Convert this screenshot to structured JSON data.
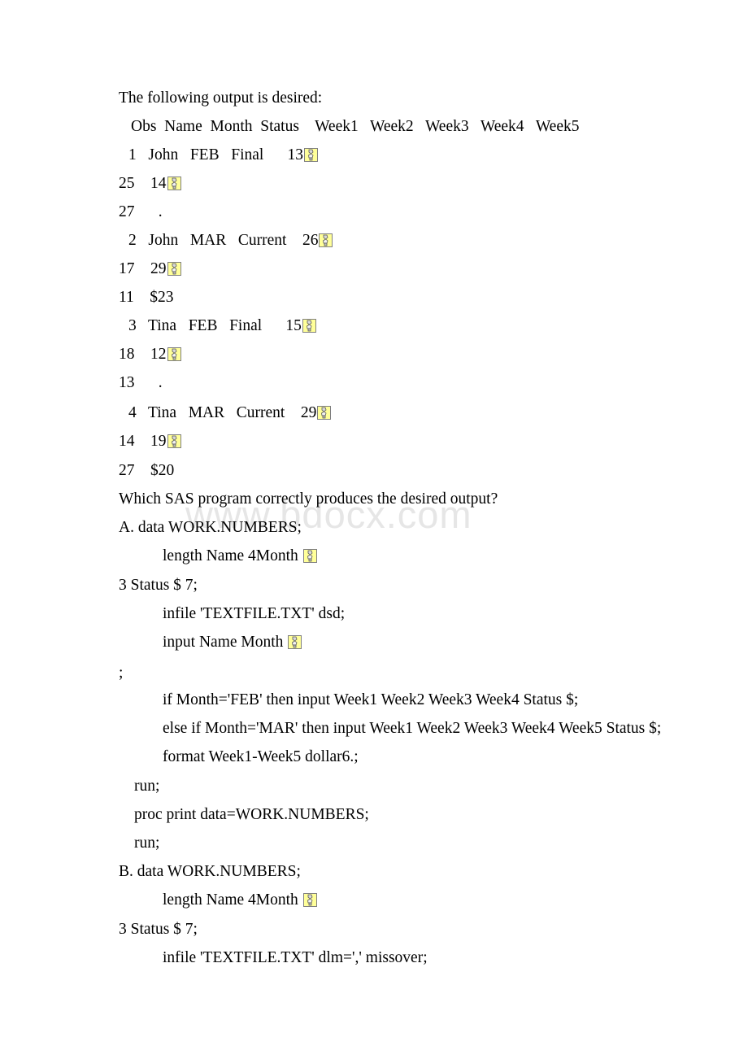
{
  "document": {
    "watermark": "www.bdocx.com",
    "intro": "The following output is desired:",
    "question": "Which SAS program correctly produces the desired output?"
  },
  "output_table": {
    "headers": [
      "Obs",
      "Name",
      "Month",
      "Status",
      "Week1",
      "Week2",
      "Week3",
      "Week4",
      "Week5"
    ],
    "rows": [
      {
        "main": "1   John   FEB   Final      13",
        "cont1": "25    14",
        "cont2": "27      ."
      },
      {
        "main": "2   John   MAR   Current    26",
        "cont1": "17    29",
        "cont2": "11    $23"
      },
      {
        "main": "3   Tina   FEB   Final      15",
        "cont1": "18    12",
        "cont2": "13      ."
      },
      {
        "main": "4   Tina   MAR   Current    29",
        "cont1": "14    19",
        "cont2": "27    $20"
      }
    ]
  },
  "choices": [
    {
      "label": "A. data WORK.NUMBERS;",
      "lines": [
        {
          "indent": "ind1",
          "text": "length Name 4Month ",
          "icon": true
        },
        {
          "indent": "ind0",
          "text": "3 Status $ 7;",
          "icon": false
        },
        {
          "indent": "ind1",
          "text": "infile 'TEXTFILE.TXT' dsd;",
          "icon": false
        },
        {
          "indent": "ind1",
          "text": "input Name Month ",
          "icon": true
        },
        {
          "indent": "ind0",
          "text": ";",
          "icon": false
        },
        {
          "indent": "ind1",
          "text": "if Month='FEB' then input Week1 Week2 Week3 Week4 Status $;",
          "icon": false
        },
        {
          "indent": "ind1",
          "text": "else if Month='MAR' then input Week1 Week2 Week3 Week4 Week5 Status $;",
          "icon": false
        },
        {
          "indent": "ind1",
          "text": "format Week1-Week5 dollar6.;",
          "icon": false
        },
        {
          "indent": "ind-sm",
          "text": "run;",
          "icon": false
        },
        {
          "indent": "ind-sm",
          "text": "proc print data=WORK.NUMBERS;",
          "icon": false
        },
        {
          "indent": "ind-sm",
          "text": "run;",
          "icon": false
        }
      ]
    },
    {
      "label": "B. data WORK.NUMBERS;",
      "lines": [
        {
          "indent": "ind1",
          "text": "length Name 4Month ",
          "icon": true
        },
        {
          "indent": "ind0",
          "text": "3 Status $ 7;",
          "icon": false
        },
        {
          "indent": "ind1",
          "text": "infile 'TEXTFILE.TXT' dlm=',' missover;",
          "icon": false
        }
      ]
    }
  ],
  "icons": {
    "placeholder": "broken-image-placeholder-icon"
  }
}
